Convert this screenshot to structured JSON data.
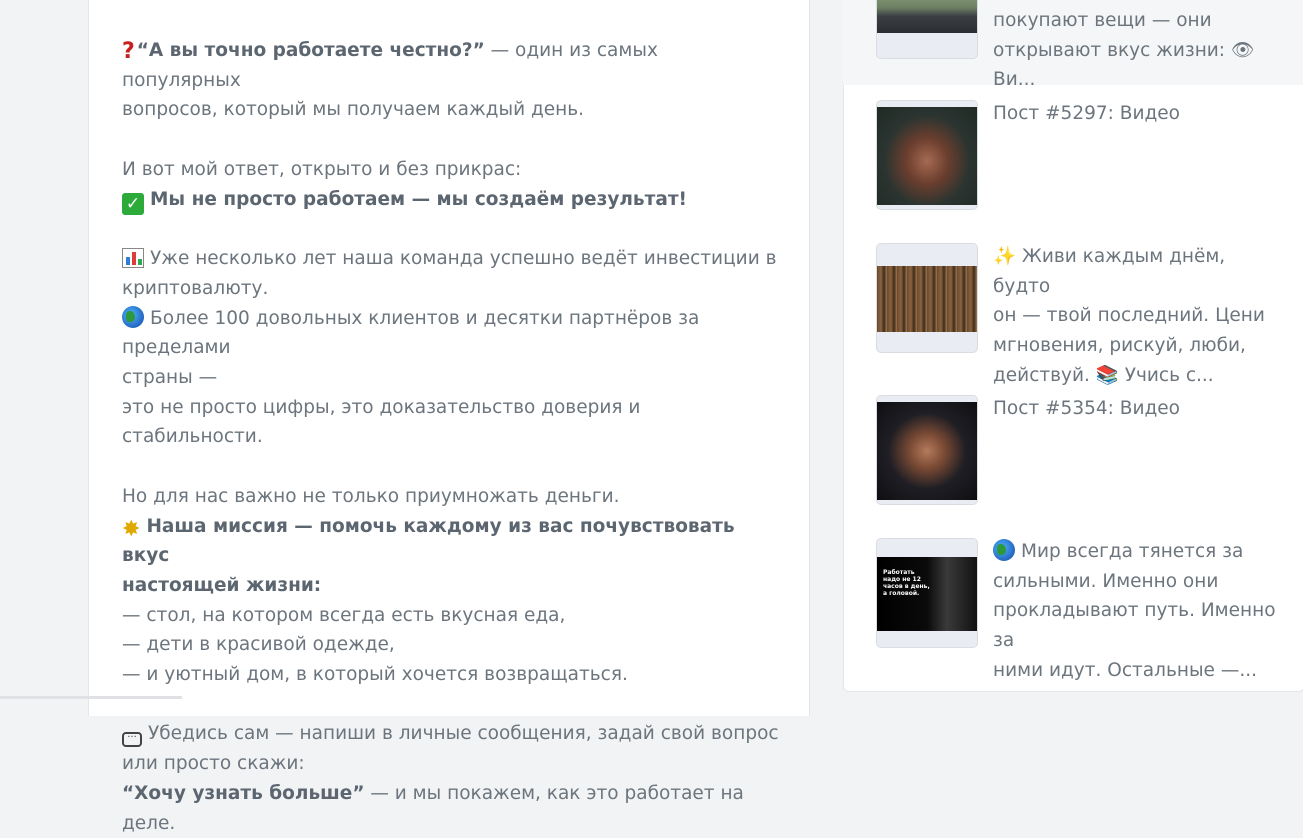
{
  "post": {
    "l1_q": "“А вы точно работаете честно?”",
    "l1_rest": " — один из самых популярных",
    "l2": "вопросов, который мы получаем каждый день.",
    "l3": "И вот мой ответ, открыто и без прикрас:",
    "l4_bold": "Мы не просто работаем — мы создаём результат!",
    "l5": "Уже несколько лет наша команда успешно ведёт инвестиции в",
    "l6": "криптовалюту.",
    "l7": "Более 100 довольных клиентов и десятки партнёров за пределами",
    "l8": "страны —",
    "l9": "это не просто цифры, это доказательство доверия и стабильности.",
    "l10": "Но для нас важно не только приумножать деньги.",
    "l11_bold": "Наша миссия — помочь каждому из вас почувствовать вкус",
    "l12_bold": "настоящей жизни:",
    "l13": "— стол, на котором всегда есть вкусная еда,",
    "l14": "— дети в красивой одежде,",
    "l15": "— и уютный дом, в который хочется возвращаться.",
    "l16": "Убедись сам — напиши в личные сообщения, задай свой вопрос",
    "l17": "или просто скажи:",
    "l18_bold": "“Хочу узнать больше”",
    "l18_rest": " — и мы покажем, как это работает на деле."
  },
  "sidebar": {
    "items": [
      {
        "line1": "покупают вещи — они",
        "line2": "открывают вкус жизни: 👁 Ви..."
      },
      {
        "line1": "Пост #5297: Видео"
      },
      {
        "line1": "✨ Живи каждым днём, будто",
        "line2": "он — твой последний. Цени",
        "line3": "мгновения, рискуй, люби,",
        "line4": "действуй. 📚 Учись с..."
      },
      {
        "line1": "Пост #5354: Видео"
      },
      {
        "line1": "Мир всегда тянется за",
        "line2": "сильными. Именно они",
        "line3": "прокладывают путь. Именно за",
        "line4": "ними идут. Остальные —..."
      }
    ],
    "thumb5_caption": "Работать надо не 12 часов в день, а головой."
  },
  "colors": {
    "text": "#6c757d",
    "bold_text": "#5c6670",
    "card_bg": "#ffffff",
    "page_bg": "#f1f3f5",
    "border": "#e3e6ea"
  }
}
